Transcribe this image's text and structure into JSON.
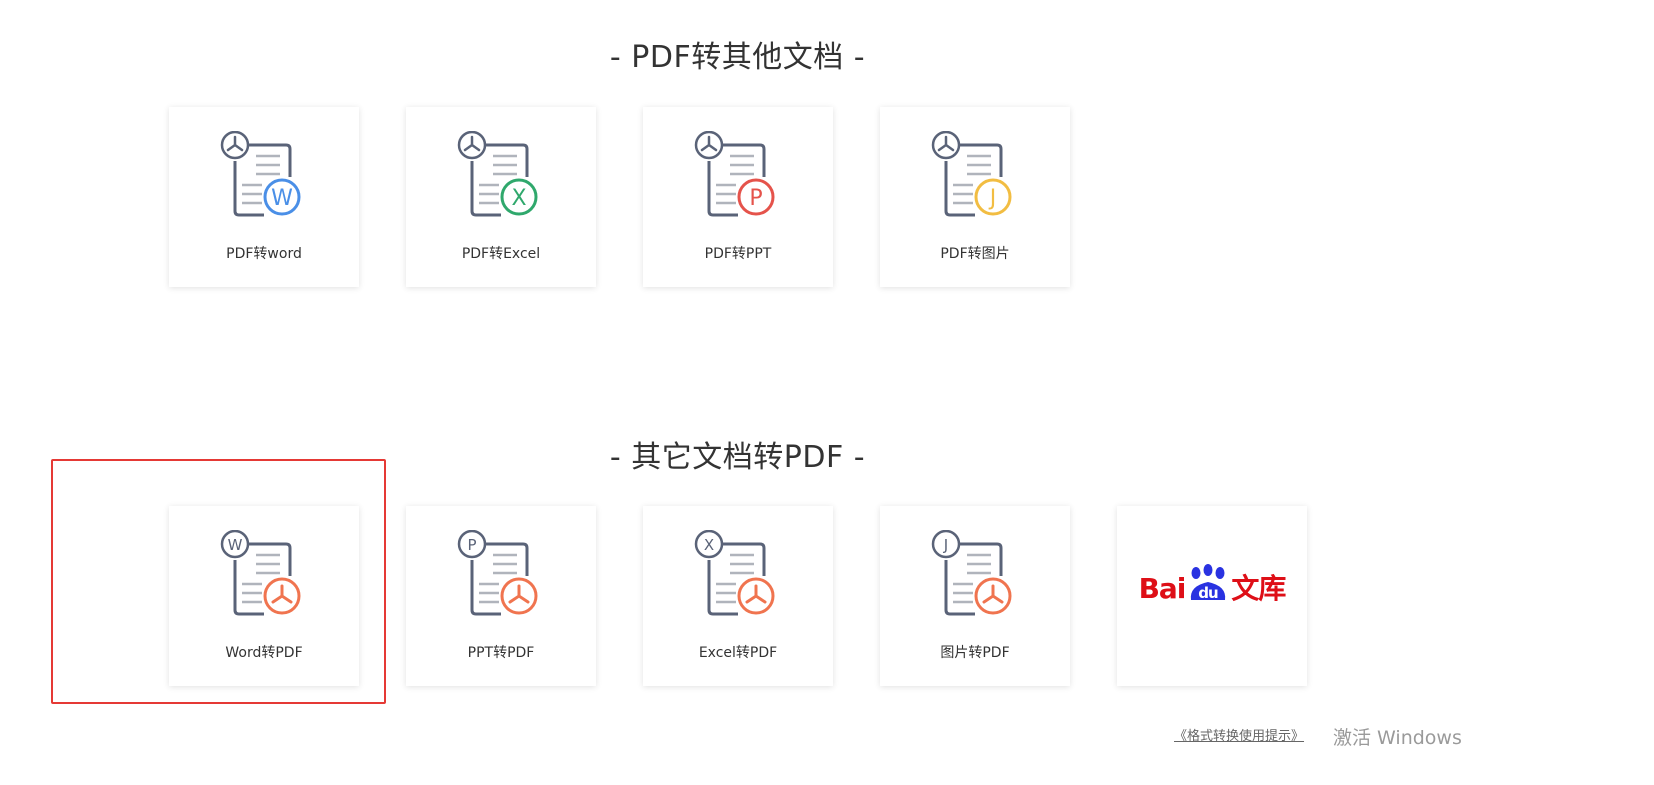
{
  "sections": {
    "pdf_to_other_title": "- PDF转其他文档 -",
    "other_to_pdf_title": "- 其它文档转PDF -"
  },
  "pdf_to_other": [
    {
      "label": "PDF转word",
      "icon": "pdf-to-word-icon",
      "badge_letter": "W",
      "badge_color": "#4a8fe7"
    },
    {
      "label": "PDF转Excel",
      "icon": "pdf-to-excel-icon",
      "badge_letter": "X",
      "badge_color": "#2fa86c"
    },
    {
      "label": "PDF转PPT",
      "icon": "pdf-to-ppt-icon",
      "badge_letter": "P",
      "badge_color": "#e5534b"
    },
    {
      "label": "PDF转图片",
      "icon": "pdf-to-image-icon",
      "badge_letter": "J",
      "badge_color": "#f2bd42"
    }
  ],
  "other_to_pdf": [
    {
      "label": "Word转PDF",
      "icon": "word-to-pdf-icon",
      "corner_letter": "W"
    },
    {
      "label": "PPT转PDF",
      "icon": "ppt-to-pdf-icon",
      "corner_letter": "P"
    },
    {
      "label": "Excel转PDF",
      "icon": "excel-to-pdf-icon",
      "corner_letter": "X"
    },
    {
      "label": "图片转PDF",
      "icon": "image-to-pdf-icon",
      "corner_letter": "J"
    }
  ],
  "baidu": {
    "part1": "Bai",
    "part2": "du",
    "part3": "文库"
  },
  "footer_link": "《格式转换使用提示》",
  "watermark": "激活 Windows",
  "colors": {
    "pdf_badge": "#f0744f",
    "doc_stroke": "#5a6378",
    "highlight": "#e53935",
    "baidu_red": "#de0f17",
    "baidu_blue": "#2932e1"
  }
}
